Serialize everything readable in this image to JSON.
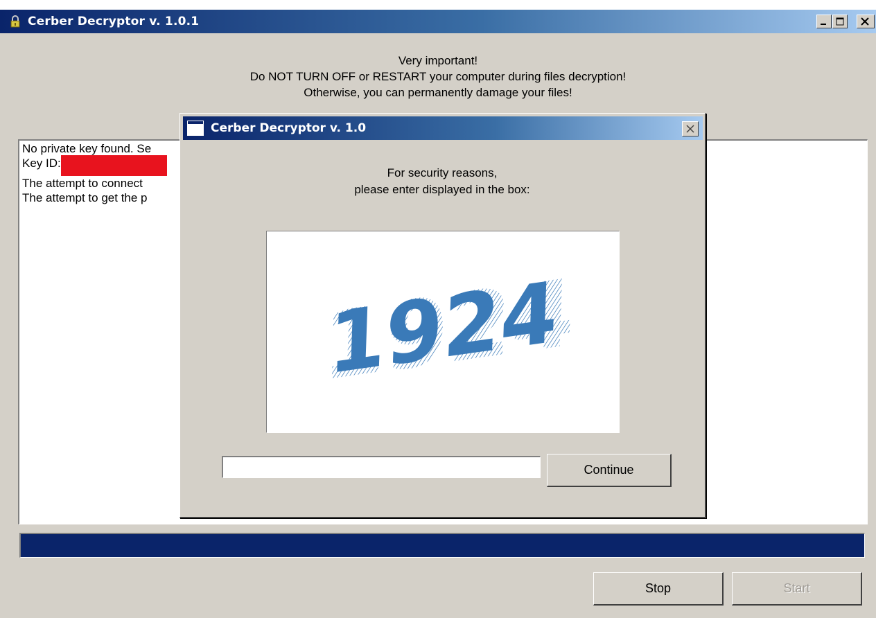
{
  "main_window": {
    "title": "Cerber Decryptor v. 1.0.1",
    "warning_lines": [
      "Very important!",
      "Do NOT TURN OFF or RESTART your computer during files decryption!",
      "Otherwise, you can permanently damage your files!"
    ],
    "log_lines": [
      "No private key found. Se",
      "Key ID:",
      "The attempt to connect",
      "The attempt to get the p"
    ],
    "progress": 1.0,
    "buttons": {
      "stop": "Stop",
      "start": "Start"
    },
    "colors": {
      "title_gradient_start": "#0a246a",
      "title_gradient_end": "#a6caf0",
      "window_bg": "#d4d0c8",
      "redaction": "#e8131e",
      "progress_bar": "#0a246a"
    }
  },
  "dialog": {
    "title": "Cerber Decryptor v. 1.0",
    "message_lines": [
      "For security reasons,",
      "please enter displayed in the box:"
    ],
    "captcha_text": "1924",
    "captcha_color": "#3a7ab8",
    "input_value": "",
    "continue_label": "Continue"
  }
}
